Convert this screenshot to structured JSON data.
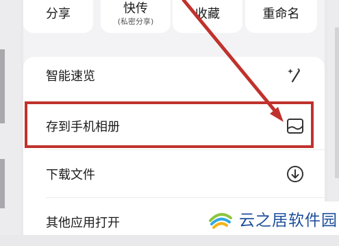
{
  "share_row": [
    {
      "label": "分享",
      "sub": ""
    },
    {
      "label": "快传",
      "sub": "(私密分享)"
    },
    {
      "label": "收藏",
      "sub": ""
    },
    {
      "label": "重命名",
      "sub": ""
    }
  ],
  "menu_items": [
    {
      "label": "智能速览",
      "icon": "sparkle-wand-icon"
    },
    {
      "label": "存到手机相册",
      "icon": "save-to-album-icon"
    },
    {
      "label": "下载文件",
      "icon": "download-icon"
    },
    {
      "label": "其他应用打开",
      "icon": "open-with-icon"
    }
  ],
  "annotation": {
    "color": "#c0322d"
  },
  "watermark": {
    "text": "云之居软件园"
  }
}
